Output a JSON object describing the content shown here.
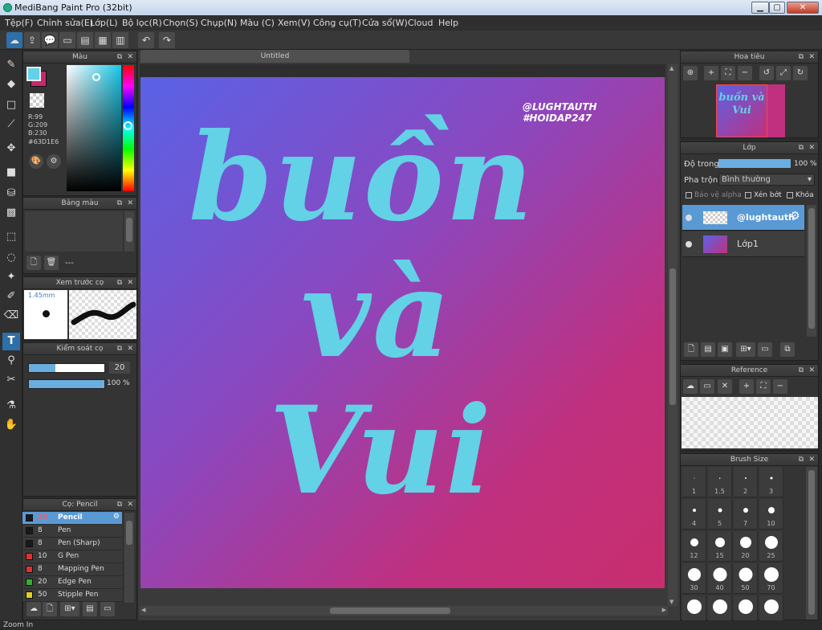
{
  "window": {
    "title": "MediBang Paint Pro (32bit)",
    "min": "▁",
    "max": "▢",
    "close": "✕"
  },
  "menu": [
    "Tệp(F)",
    "Chỉnh sửa(E)",
    "Lớp(L)",
    "Bộ lọc(R)",
    "Chọn(S)",
    "Chụp(N)",
    "Màu (C)",
    "Xem(V)",
    "Công cụ(T)",
    "Cửa sổ(W)",
    "Cloud",
    "Help"
  ],
  "color_panel": {
    "title": "Màu",
    "r": "R:99",
    "g": "G:209",
    "b": "B:230",
    "hex": "#63D1E6",
    "primary": "#63D1E6",
    "secondary": "#C8286E"
  },
  "palette_panel": {
    "title": "Bảng màu",
    "label": "---"
  },
  "brush_preview": {
    "title": "Xem trước cọ",
    "size": "1.45mm"
  },
  "brush_control": {
    "title": "Kiểm soát cọ",
    "size_value": "20",
    "opacity_value": "100 %",
    "size_fraction": 0.35,
    "opacity_fraction": 1.0
  },
  "brush_list": {
    "title": "Cọ: Pencil",
    "items": [
      {
        "size": "20",
        "name": "Pencil",
        "color": "#1a1a1a",
        "selected": true
      },
      {
        "size": "8",
        "name": "Pen",
        "color": "#1a1a1a"
      },
      {
        "size": "8",
        "name": "Pen (Sharp)",
        "color": "#1a1a1a"
      },
      {
        "size": "10",
        "name": "G Pen",
        "color": "#e03030"
      },
      {
        "size": "8",
        "name": "Mapping Pen",
        "color": "#e03030"
      },
      {
        "size": "20",
        "name": "Edge Pen",
        "color": "#30b030"
      },
      {
        "size": "50",
        "name": "Stipple Pen",
        "color": "#e0d020"
      }
    ]
  },
  "canvas": {
    "tab": "Untitled",
    "lines": [
      "buồn",
      "và",
      "Vui"
    ],
    "watermark_1": "@LUGHTAUTH",
    "watermark_2": "#HOIDAP247",
    "text_color": "#63D1E6"
  },
  "navigator": {
    "title": "Hoa tiêu",
    "thumb_text": "buồn và Vui"
  },
  "layers": {
    "title": "Lớp",
    "opacity_label": "Độ trong",
    "opacity_value": "100 %",
    "blend_label": "Pha trộn",
    "blend_value": "Bình thường",
    "protect_alpha": "Bảo vệ alpha",
    "clipping": "Xén bớt",
    "lock": "Khóa",
    "items": [
      {
        "name": "@lughtauth",
        "selected": true
      },
      {
        "name": "Lớp1",
        "selected": false
      }
    ]
  },
  "reference": {
    "title": "Reference"
  },
  "brush_size": {
    "title": "Brush Size",
    "sizes": [
      "1",
      "1.5",
      "2",
      "3",
      "4",
      "5",
      "7",
      "10",
      "12",
      "15",
      "20",
      "25",
      "30",
      "40",
      "50",
      "70",
      "",
      "",
      "",
      ""
    ]
  },
  "status": {
    "text": "Zoom In"
  }
}
